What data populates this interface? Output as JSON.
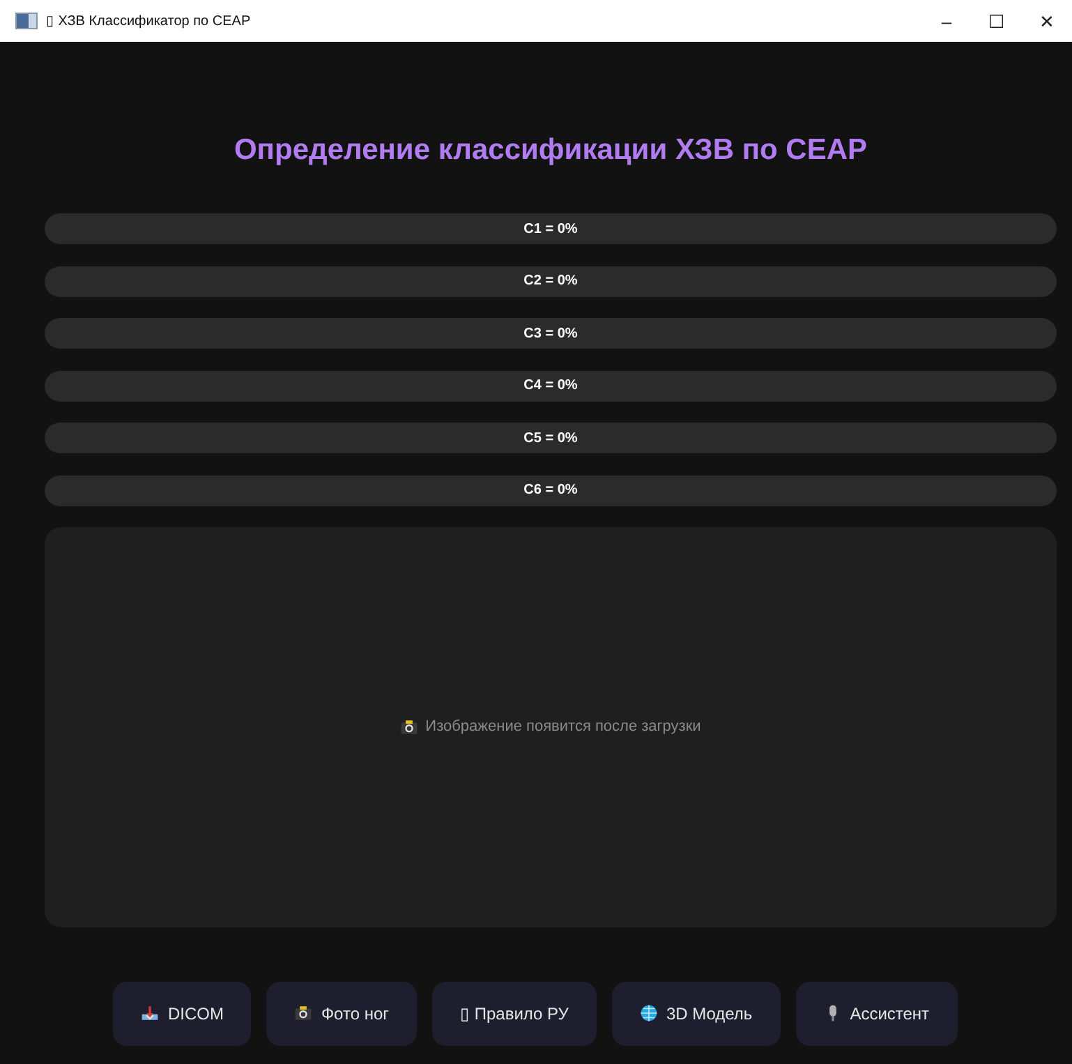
{
  "window": {
    "title": "▯ ХЗВ Классификатор по CEAP",
    "controls": [
      "–",
      "☐",
      "✕"
    ]
  },
  "heading": "Определение классификации ХЗВ по CEAP",
  "bars": [
    {
      "label": "C1 = 0%",
      "level": 0
    },
    {
      "label": "C2 = 0%",
      "level": 0
    },
    {
      "label": "C3 = 0%",
      "level": 0
    },
    {
      "label": "C4 = 0%",
      "level": 0
    },
    {
      "label": "C5 = 0%",
      "level": 0
    },
    {
      "label": "C6 = 0%",
      "level": 0
    }
  ],
  "image_panel": {
    "kind": "camera",
    "text": "Изображение появится после загрузки"
  },
  "buttons": [
    {
      "kind": "upload",
      "label": "DICOM"
    },
    {
      "kind": "camera",
      "label": "Фото ног"
    },
    {
      "kind": "plain",
      "label": "▯ Правило РУ"
    },
    {
      "kind": "globe",
      "label": "3D Модель"
    },
    {
      "kind": "mic",
      "label": "Ассистент"
    }
  ]
}
